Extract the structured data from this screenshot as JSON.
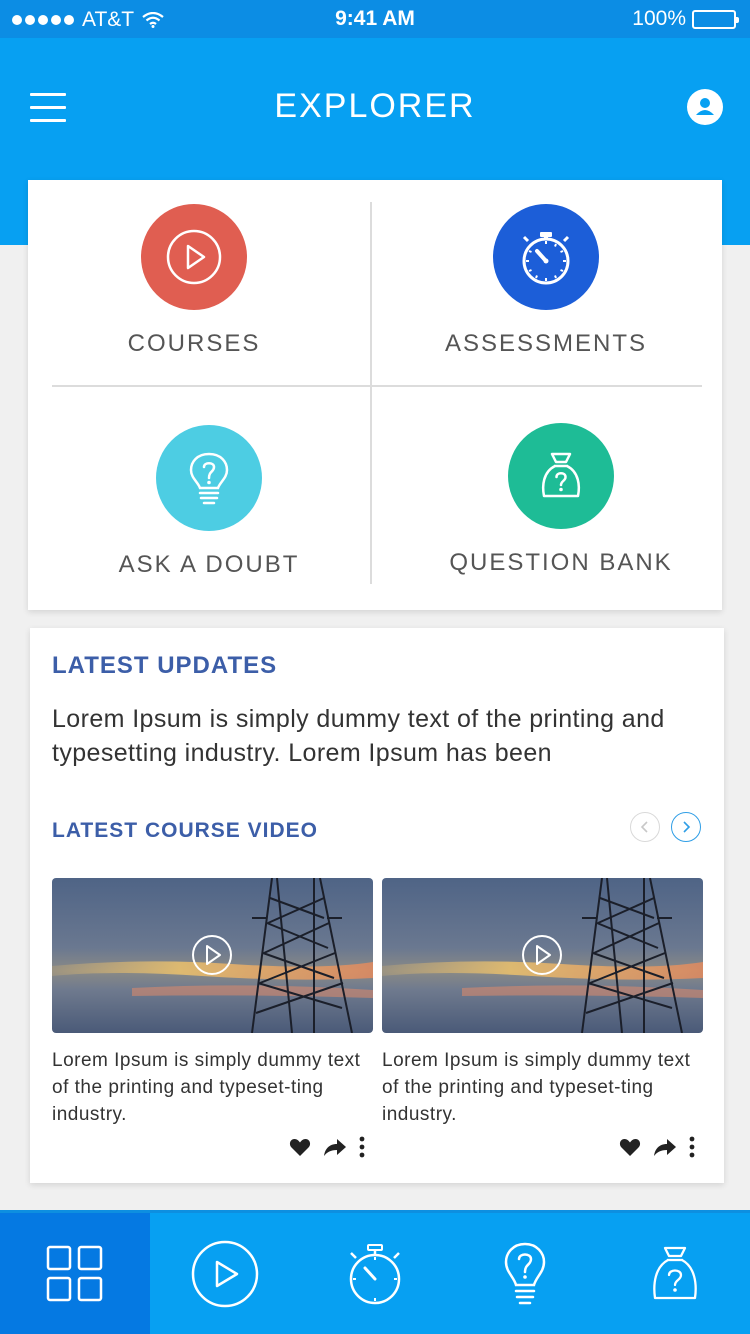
{
  "status_bar": {
    "carrier": "AT&T",
    "time": "9:41 AM",
    "battery": "100%"
  },
  "header": {
    "title": "EXPLORER",
    "color": "#07a0f2"
  },
  "tiles": [
    {
      "label": "COURSES",
      "icon": "play-icon",
      "color": "#e05e51"
    },
    {
      "label": "ASSESSMENTS",
      "icon": "stopwatch-icon",
      "color": "#1c5ed8"
    },
    {
      "label": "ASK A DOUBT",
      "icon": "lightbulb-icon",
      "color": "#4dcde3"
    },
    {
      "label": "QUESTION BANK",
      "icon": "question-bag-icon",
      "color": "#1ebc96"
    }
  ],
  "latest_updates": {
    "title": "LATEST UPDATES",
    "text": "Lorem Ipsum is simply dummy text of the printing and typesetting industry. Lorem Ipsum has been"
  },
  "latest_course_video": {
    "title": "LATEST COURSE VIDEO",
    "videos": [
      {
        "description": "Lorem Ipsum is simply dummy text of the printing and typeset-ting industry."
      },
      {
        "description": "Lorem Ipsum is simply dummy text of the printing and typeset-ting industry."
      }
    ]
  },
  "tab_bar": {
    "items": [
      "grid-icon",
      "play-icon",
      "stopwatch-icon",
      "lightbulb-icon",
      "question-bag-icon"
    ],
    "active_index": 0
  },
  "colors": {
    "accent_heading": "#3c5ea8",
    "tab_active": "#0579e2"
  }
}
